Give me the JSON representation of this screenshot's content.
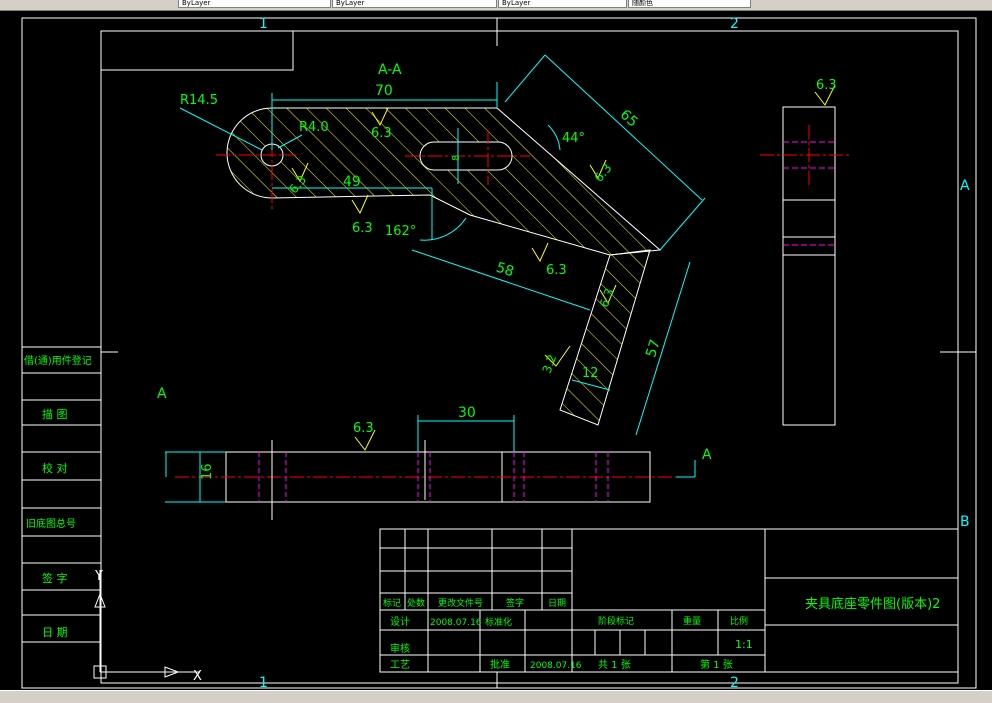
{
  "toolbar": {
    "fields": [
      "ByLayer",
      "ByLayer",
      "ByLayer",
      "随颜色"
    ]
  },
  "drawing": {
    "border_zone_top_1": "1",
    "border_zone_top_2": "2",
    "border_zone_bottom_1": "1",
    "border_zone_bottom_2": "2",
    "border_zone_right_a": "A",
    "border_zone_right_b": "B",
    "section_title": "A-A",
    "section_arrow_left": "A",
    "section_arrow_right": "A",
    "dims": {
      "r145": "R14.5",
      "r40": "R4.0",
      "d70": "70",
      "d49": "49",
      "d65": "65",
      "d58": "58",
      "d57": "57",
      "d12": "12",
      "d8": "8",
      "d30": "30",
      "d16": "16",
      "a44": "44°",
      "a162": "162°"
    },
    "roughness": [
      "6.3",
      "6.3",
      "6.3",
      "6.3",
      "6.3",
      "6.3",
      "6.3",
      "6.3",
      "3.2"
    ],
    "ucs_y": "Y",
    "ucs_x": "X"
  },
  "left_strip": {
    "cells": [
      "借(通)用件登记",
      "描 图",
      "校 对",
      "旧底图总号",
      "签 字",
      "日 期"
    ]
  },
  "title_block": {
    "part_name": "夹具底座零件图(版本)2",
    "scale": "1:1",
    "row_labels": [
      "标记",
      "处数",
      "更改文件号",
      "签字",
      "日期"
    ],
    "design": "设计",
    "check": "审核",
    "process": "工艺",
    "date_value": "2008.07.16",
    "std": "标准化",
    "approve": "批准",
    "stage_mark": "阶段标记",
    "weight": "重量",
    "ratio": "比例",
    "sheets_total": "共 1 张",
    "sheet_no": "第 1 张"
  },
  "colors": {
    "frame": "#ffffff",
    "dimension": "#00ffff",
    "dim_text": "#00ff00",
    "centerline": "#ff0000",
    "hatch": "#ffff00",
    "hidden": "#ff00ff",
    "roughness": "#ffff00"
  }
}
